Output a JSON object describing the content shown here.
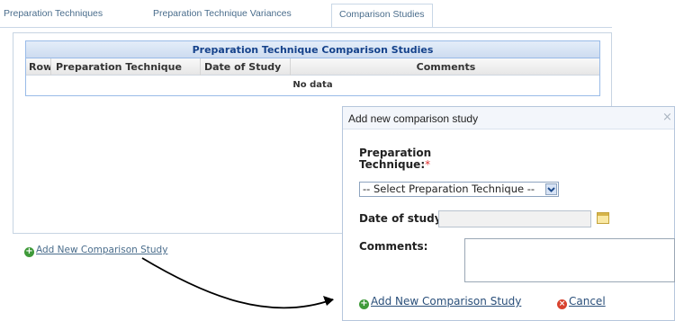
{
  "tabs": [
    {
      "label": "Preparation Techniques"
    },
    {
      "label": "Preparation Technique Variances"
    },
    {
      "label": "Comparison Studies"
    }
  ],
  "grid": {
    "title": "Preparation Technique Comparison Studies",
    "columns": [
      "Row",
      "Preparation Technique",
      "Date of Study",
      "Comments"
    ],
    "empty_text": "No data"
  },
  "add_link": "Add New Comparison Study",
  "dialog": {
    "title": "Add new comparison study",
    "close_glyph": "×",
    "prep_label": "Preparation Technique:",
    "select_value": "-- Select Preparation Technique --",
    "date_label": "Date of study:",
    "comments_label": "Comments:",
    "required_mark": "*",
    "add_label": "Add New Comparison Study",
    "cancel_label": "Cancel"
  },
  "colors": {
    "link": "#4a6d8c",
    "grid_header": "#15428b",
    "add_icon": "#3f9a3a",
    "cancel_icon": "#d8432f",
    "required": "#e03030"
  }
}
